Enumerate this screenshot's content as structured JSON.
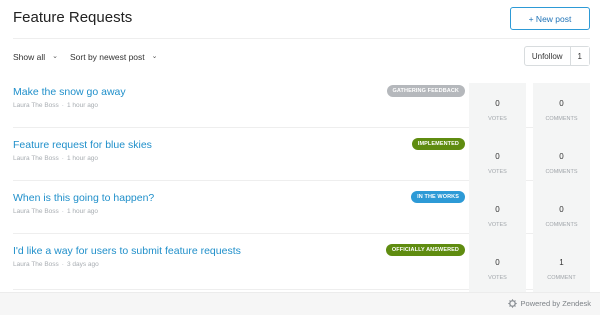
{
  "header": {
    "title": "Feature Requests",
    "new_post_label": "+ New post"
  },
  "toolbar": {
    "show_filter": "Show all",
    "sort_filter": "Sort by newest post",
    "unfollow_label": "Unfollow",
    "unfollow_count": "1"
  },
  "posts": [
    {
      "title": "Make the snow go away",
      "author": "Laura The Boss",
      "time": "1 hour ago",
      "status": "GATHERING FEEDBACK",
      "status_color": "#b5b8bc",
      "votes": "0",
      "votes_label": "VOTES",
      "comments": "0",
      "comments_label": "COMMENTS"
    },
    {
      "title": "Feature request for blue skies",
      "author": "Laura The Boss",
      "time": "1 hour ago",
      "status": "IMPLEMENTED",
      "status_color": "#5f8c10",
      "votes": "0",
      "votes_label": "VOTES",
      "comments": "0",
      "comments_label": "COMMENTS"
    },
    {
      "title": "When is this going to happen?",
      "author": "Laura The Boss",
      "time": "1 hour ago",
      "status": "IN THE WORKS",
      "status_color": "#2d9ad6",
      "votes": "0",
      "votes_label": "VOTES",
      "comments": "0",
      "comments_label": "COMMENTS"
    },
    {
      "title": "I'd like a way for users to submit feature requests",
      "author": "Laura The Boss",
      "time": "3 days ago",
      "status": "OFFICIALLY ANSWERED",
      "status_color": "#5f8c10",
      "votes": "0",
      "votes_label": "VOTES",
      "comments": "1",
      "comments_label": "COMMENT"
    }
  ],
  "footer": {
    "powered_by": "Powered by Zendesk",
    "icon": "zendesk-gear-icon"
  }
}
